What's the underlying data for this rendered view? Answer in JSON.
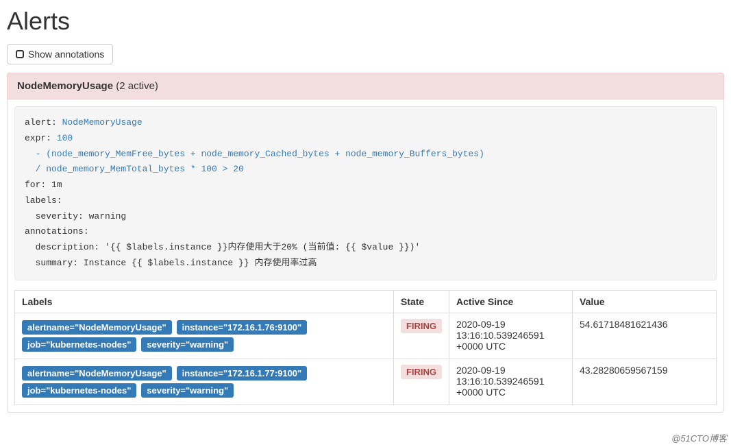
{
  "page": {
    "title": "Alerts",
    "show_annotations_label": "Show annotations"
  },
  "alert_group": {
    "name": "NodeMemoryUsage",
    "active_count_label": "(2 active)"
  },
  "rule_yaml": {
    "l1_key": "alert:",
    "l1_val": "NodeMemoryUsage",
    "l2_key": "expr:",
    "l2_val": "100",
    "l3": "  - (node_memory_MemFree_bytes + node_memory_Cached_bytes + node_memory_Buffers_bytes)",
    "l4": "  / node_memory_MemTotal_bytes * 100 > 20",
    "l5": "for: 1m",
    "l6": "labels:",
    "l7": "  severity: warning",
    "l8": "annotations:",
    "l9": "  description: '{{ $labels.instance }}内存使用大于20% (当前值: {{ $value }})'",
    "l10": "  summary: Instance {{ $labels.instance }} 内存使用率过高"
  },
  "table": {
    "headers": {
      "labels": "Labels",
      "state": "State",
      "active_since": "Active Since",
      "value": "Value"
    },
    "rows": [
      {
        "labels": [
          "alertname=\"NodeMemoryUsage\"",
          "instance=\"172.16.1.76:9100\"",
          "job=\"kubernetes-nodes\"",
          "severity=\"warning\""
        ],
        "state": "FIRING",
        "active_since": "2020-09-19 13:16:10.539246591 +0000 UTC",
        "value": "54.61718481621436"
      },
      {
        "labels": [
          "alertname=\"NodeMemoryUsage\"",
          "instance=\"172.16.1.77:9100\"",
          "job=\"kubernetes-nodes\"",
          "severity=\"warning\""
        ],
        "state": "FIRING",
        "active_since": "2020-09-19 13:16:10.539246591 +0000 UTC",
        "value": "43.28280659567159"
      }
    ]
  },
  "watermark": "@51CTO博客"
}
